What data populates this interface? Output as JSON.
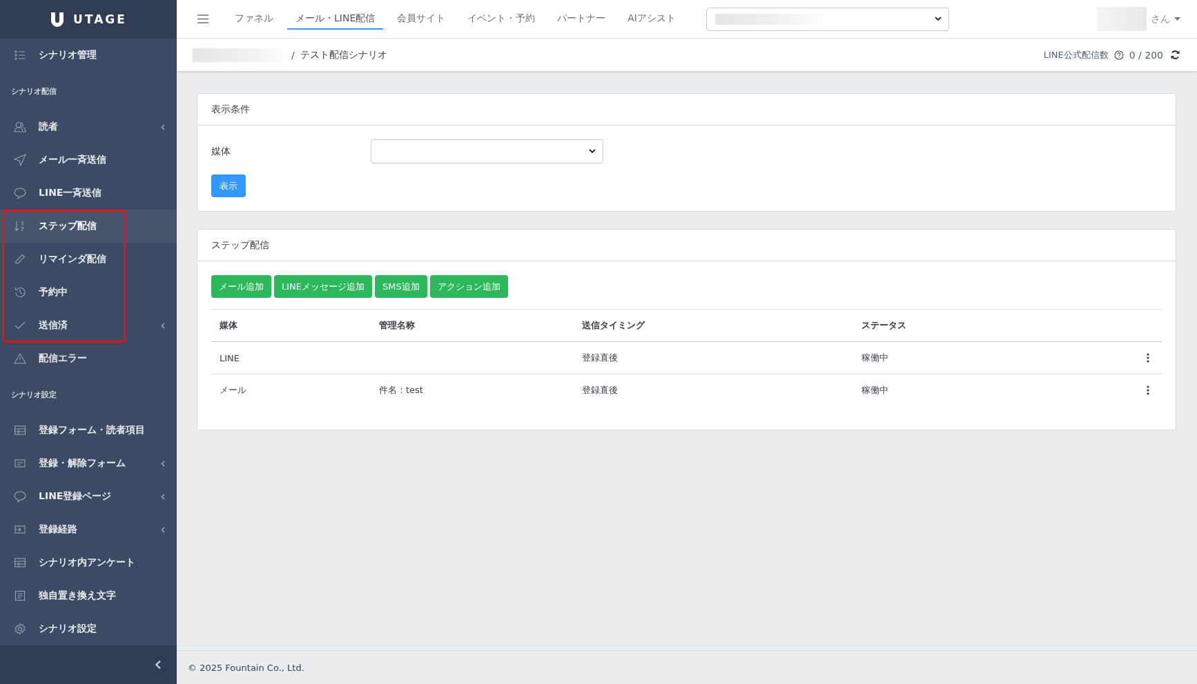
{
  "brand": {
    "name": "UTAGE"
  },
  "sidebar": {
    "top_item": {
      "label": "シナリオ管理",
      "selected": false,
      "has_submenu": false
    },
    "sections": [
      {
        "title": "シナリオ配信",
        "items": [
          {
            "label": "読者",
            "selected": false,
            "has_submenu": true,
            "highlighted": false
          },
          {
            "label": "メール一斉送信",
            "selected": false,
            "has_submenu": false,
            "highlighted": false
          },
          {
            "label": "LINE一斉送信",
            "selected": false,
            "has_submenu": false,
            "highlighted": false
          },
          {
            "label": "ステップ配信",
            "selected": true,
            "has_submenu": false,
            "highlighted": true
          },
          {
            "label": "リマインダ配信",
            "selected": false,
            "has_submenu": false,
            "highlighted": true
          },
          {
            "label": "予約中",
            "selected": false,
            "has_submenu": false,
            "highlighted": true
          },
          {
            "label": "送信済",
            "selected": false,
            "has_submenu": true,
            "highlighted": true
          },
          {
            "label": "配信エラー",
            "selected": false,
            "has_submenu": false,
            "highlighted": false
          }
        ]
      },
      {
        "title": "シナリオ設定",
        "items": [
          {
            "label": "登録フォーム・読者項目",
            "selected": false,
            "has_submenu": false,
            "highlighted": false
          },
          {
            "label": "登録・解除フォーム",
            "selected": false,
            "has_submenu": true,
            "highlighted": false
          },
          {
            "label": "LINE登録ページ",
            "selected": false,
            "has_submenu": true,
            "highlighted": false
          },
          {
            "label": "登録経路",
            "selected": false,
            "has_submenu": true,
            "highlighted": false
          },
          {
            "label": "シナリオ内アンケート",
            "selected": false,
            "has_submenu": false,
            "highlighted": false
          },
          {
            "label": "独自置き換え文字",
            "selected": false,
            "has_submenu": false,
            "highlighted": false
          },
          {
            "label": "シナリオ設定",
            "selected": false,
            "has_submenu": false,
            "highlighted": false
          }
        ]
      }
    ]
  },
  "top_nav": {
    "tabs": [
      {
        "label": "ファネル",
        "selected": false
      },
      {
        "label": "メール・LINE配信",
        "selected": true
      },
      {
        "label": "会員サイト",
        "selected": false
      },
      {
        "label": "イベント・予約",
        "selected": false
      },
      {
        "label": "パートナー",
        "selected": false
      },
      {
        "label": "AIアシスト",
        "selected": false
      }
    ],
    "user_suffix": "さん"
  },
  "breadcrumb": {
    "current": "テスト配信シナリオ",
    "separator": "/"
  },
  "line_quota": {
    "label": "LINE公式配信数",
    "value": "0 / 200"
  },
  "filter_card": {
    "title": "表示条件",
    "field_label": "媒体",
    "button": "表示"
  },
  "step_card": {
    "title": "ステップ配信",
    "buttons": [
      "メール追加",
      "LINEメッセージ追加",
      "SMS追加",
      "アクション追加"
    ],
    "table": {
      "columns": [
        "媒体",
        "管理名称",
        "送信タイミング",
        "ステータス"
      ],
      "rows": [
        {
          "medium": "LINE",
          "timing": "登録直後",
          "status": "稼働中"
        },
        {
          "medium": "メール",
          "name": "件名：test",
          "timing": "登録直後",
          "status": "稼働中"
        }
      ]
    }
  },
  "footer": {
    "copyright": "© 2025 Fountain Co., Ltd."
  }
}
